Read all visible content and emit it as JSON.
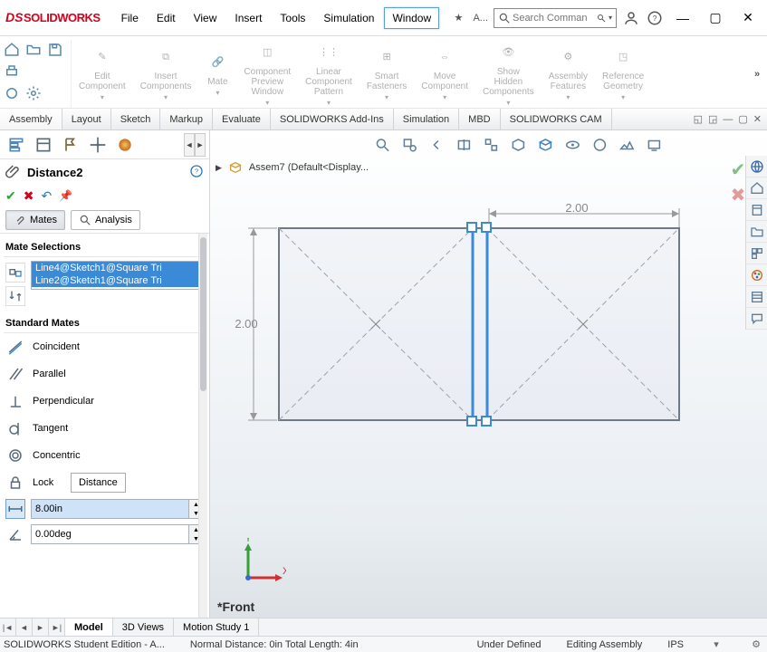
{
  "app": {
    "logo_text": "SOLIDWORKS",
    "search_placeholder": "Search Comman"
  },
  "menu": {
    "items": [
      "File",
      "Edit",
      "View",
      "Insert",
      "Tools",
      "Simulation",
      "Window"
    ],
    "active_index": 6,
    "extra": "A..."
  },
  "ribbon": {
    "groups": [
      "Edit Component",
      "Insert Components",
      "Mate",
      "Component Preview Window",
      "Linear Component Pattern",
      "Smart Fasteners",
      "Move Component",
      "Show Hidden Components",
      "Assembly Features",
      "Reference Geometry"
    ]
  },
  "cmd_tabs": {
    "items": [
      "Assembly",
      "Layout",
      "Sketch",
      "Markup",
      "Evaluate",
      "SOLIDWORKS Add-Ins",
      "Simulation",
      "MBD",
      "SOLIDWORKS CAM"
    ],
    "active_index": 0
  },
  "feature": {
    "name": "Distance2",
    "mates_tab": "Mates",
    "analysis_tab": "Analysis"
  },
  "mate_selections": {
    "title": "Mate Selections",
    "items": [
      "Line4@Sketch1@Square Tri",
      "Line2@Sketch1@Square Tri"
    ]
  },
  "standard_mates": {
    "title": "Standard Mates",
    "items": [
      "Coincident",
      "Parallel",
      "Perpendicular",
      "Tangent",
      "Concentric",
      "Lock"
    ],
    "tooltip": "Distance",
    "distance_value": "8.00in",
    "angle_value": "0.00deg"
  },
  "gfx": {
    "breadcrumb": "Assem7  (Default<Display...",
    "view_label": "*Front",
    "dim_h": "2.00",
    "dim_v": "2.00"
  },
  "sheet_tabs": {
    "items": [
      "Model",
      "3D Views",
      "Motion Study 1"
    ],
    "active_index": 0
  },
  "status": {
    "left": "SOLIDWORKS Student Edition - A...",
    "info": "Normal Distance: 0in Total Length: 4in",
    "center": "Under Defined",
    "mode": "Editing Assembly",
    "units": "IPS"
  }
}
